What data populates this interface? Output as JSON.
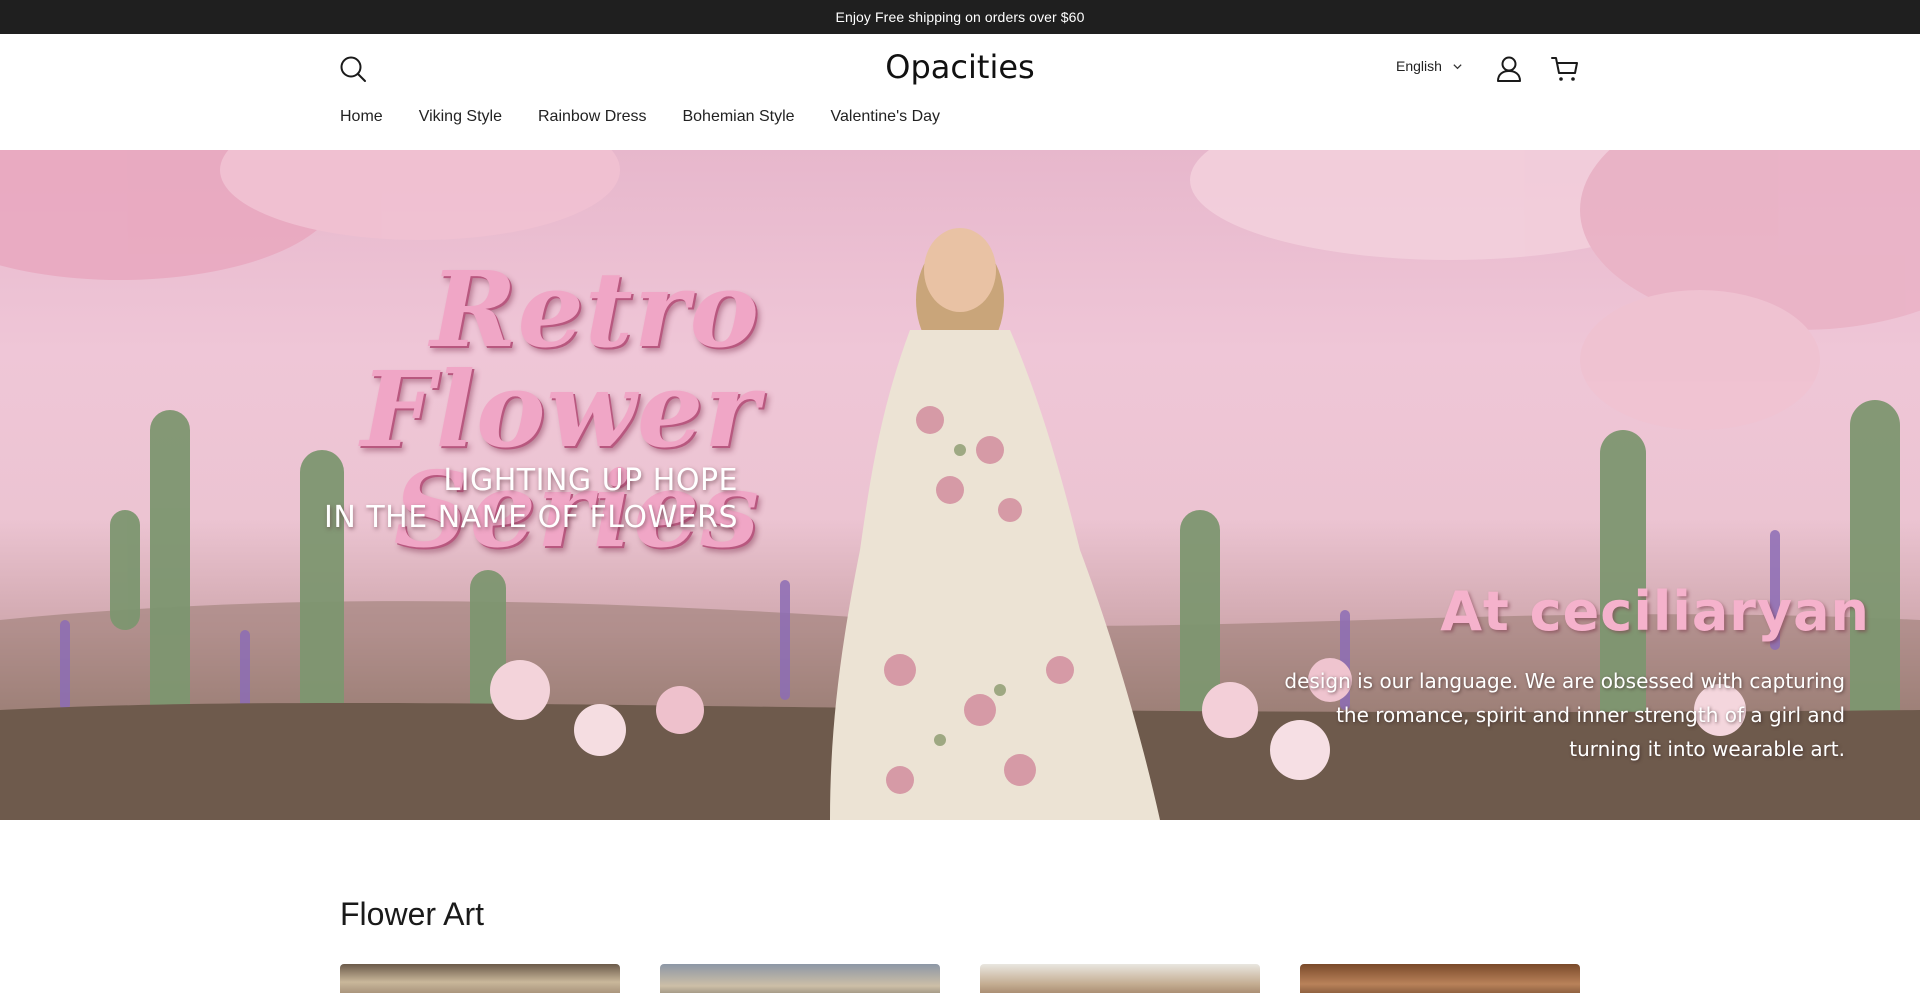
{
  "announcement": {
    "text": "Enjoy Free shipping on orders over $60"
  },
  "header": {
    "logo": "Opacities",
    "language": {
      "selected": "English"
    },
    "icons": {
      "search": "search-icon",
      "account": "account-icon",
      "cart": "cart-icon"
    }
  },
  "nav": {
    "items": [
      {
        "label": "Home"
      },
      {
        "label": "Viking Style"
      },
      {
        "label": "Rainbow Dress"
      },
      {
        "label": "Bohemian Style"
      },
      {
        "label": "Valentine's Day"
      }
    ]
  },
  "hero": {
    "title_line1": "Retro Flower",
    "title_line2": "Series",
    "subtitle_line1": "LIGHTING UP HOPE",
    "subtitle_line2": "IN THE NAME OF FLOWERS",
    "brand": "At ceciliaryan",
    "desc_line1": "design is our language. We are obsessed with capturing",
    "desc_line2": "the romance, spirit and inner strength of a girl and",
    "desc_line3": "turning it into wearable art."
  },
  "section": {
    "title": "Flower Art"
  },
  "colors": {
    "announcement_bg": "#1f1f1f",
    "hero_pink": "#efc6d7",
    "title_pink": "#f0a6c6",
    "brand_pink": "#f5b2cc"
  }
}
